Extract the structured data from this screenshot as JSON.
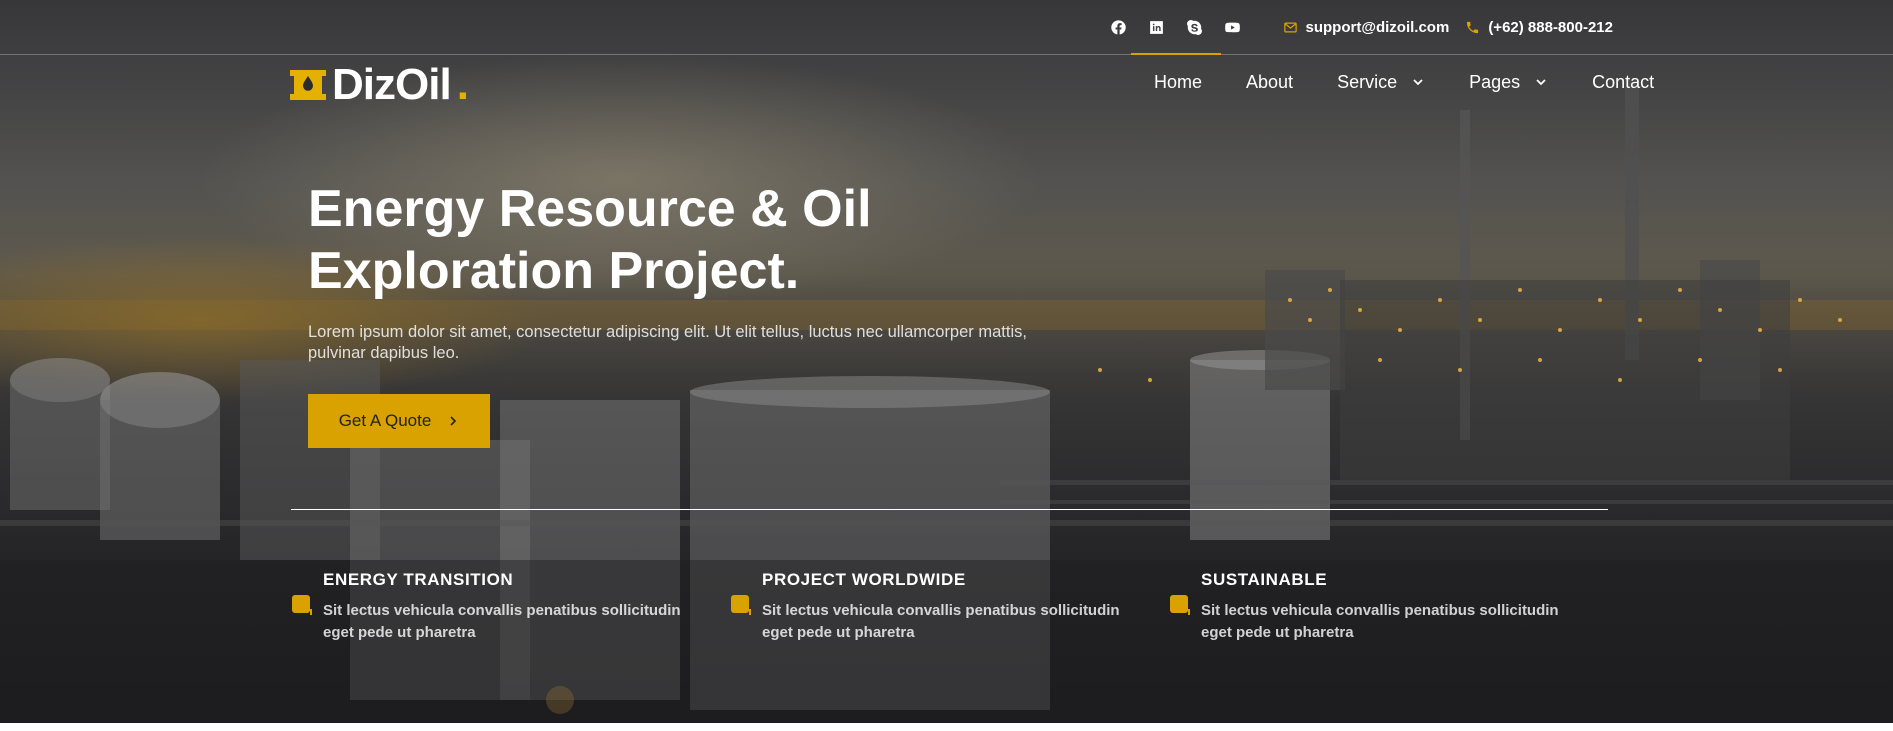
{
  "colors": {
    "accent": "#d9a200",
    "text": "#ffffff",
    "overlay": "#2b2b2e"
  },
  "topbar": {
    "social": [
      {
        "name": "facebook",
        "icon": "facebook-icon"
      },
      {
        "name": "linkedin",
        "icon": "linkedin-icon"
      },
      {
        "name": "skype",
        "icon": "skype-icon"
      },
      {
        "name": "youtube",
        "icon": "youtube-icon"
      }
    ],
    "email": "support@dizoil.com",
    "phone": "(+62) 888-800-212"
  },
  "logo": {
    "name": "DizOil",
    "dot": "."
  },
  "nav": {
    "items": [
      {
        "label": "Home",
        "active": true,
        "dropdown": false
      },
      {
        "label": "About",
        "active": false,
        "dropdown": false
      },
      {
        "label": "Service",
        "active": false,
        "dropdown": true
      },
      {
        "label": "Pages",
        "active": false,
        "dropdown": true
      },
      {
        "label": "Contact",
        "active": false,
        "dropdown": false
      }
    ]
  },
  "hero": {
    "title_line1": "Energy Resource & Oil",
    "title_line2": "Exploration Project.",
    "description_line1": "Lorem ipsum dolor sit amet, consectetur adipiscing elit. Ut elit tellus, luctus nec ullamcorper mattis,",
    "description_line2": "pulvinar dapibus leo.",
    "cta_label": "Get A Quote"
  },
  "features": [
    {
      "title": "ENERGY TRANSITION",
      "text": "Sit lectus vehicula convallis penatibus sollicitudin eget pede ut pharetra"
    },
    {
      "title": "PROJECT WORLDWIDE",
      "text": "Sit lectus vehicula convallis penatibus sollicitudin eget pede ut pharetra"
    },
    {
      "title": "SUSTAINABLE",
      "text": "Sit lectus vehicula convallis penatibus sollicitudin eget pede ut pharetra"
    }
  ]
}
